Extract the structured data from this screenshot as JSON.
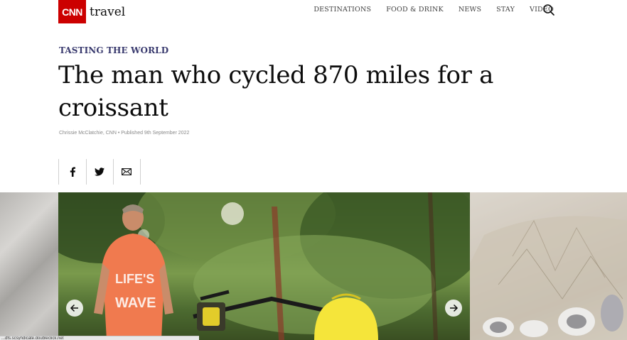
{
  "brand": {
    "logo_text": "CNN",
    "section_label": "travel",
    "brand_color": "#cc0000"
  },
  "nav": {
    "items": [
      {
        "label": "DESTINATIONS"
      },
      {
        "label": "FOOD & DRINK"
      },
      {
        "label": "NEWS"
      },
      {
        "label": "STAY"
      },
      {
        "label": "VIDEO"
      }
    ],
    "search_icon": "search-icon"
  },
  "article": {
    "kicker": "TASTING THE WORLD",
    "kicker_color": "#3a3b6f",
    "headline": "The man who cycled 870 miles for a croissant",
    "byline": "Chrissie McClatchie, CNN • Published 9th September 2022"
  },
  "share": {
    "buttons": [
      {
        "icon": "facebook-icon"
      },
      {
        "icon": "twitter-icon"
      },
      {
        "icon": "email-icon"
      }
    ]
  },
  "gallery": {
    "prev_icon": "arrow-left-icon",
    "next_icon": "arrow-right-icon"
  },
  "status_bar": {
    "text": "...dfs.scsyndicate.doubleclick.net"
  }
}
